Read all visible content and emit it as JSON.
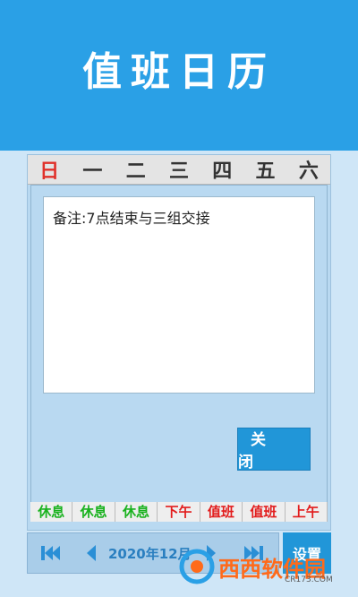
{
  "banner": {
    "title": "值班日历"
  },
  "weekdays": [
    "日",
    "一",
    "二",
    "三",
    "四",
    "五",
    "六"
  ],
  "dialog": {
    "note": "备注:7点结束与三组交接",
    "close_label": "关 闭"
  },
  "day_strip": [
    {
      "label": "休息",
      "status": "green"
    },
    {
      "label": "休息",
      "status": "green"
    },
    {
      "label": "休息",
      "status": "green"
    },
    {
      "label": "下午",
      "status": "red"
    },
    {
      "label": "值班",
      "status": "red"
    },
    {
      "label": "值班",
      "status": "red"
    },
    {
      "label": "上午",
      "status": "red"
    }
  ],
  "navigation": {
    "month_label": "2020年12月",
    "settings_label": "设置"
  },
  "watermark": {
    "text": "西西软件园",
    "sub": "CR173.COM"
  },
  "colors": {
    "banner": "#2aa0e6",
    "button": "#2196d8",
    "rest": "#19b21e",
    "duty": "#e21c1c"
  }
}
